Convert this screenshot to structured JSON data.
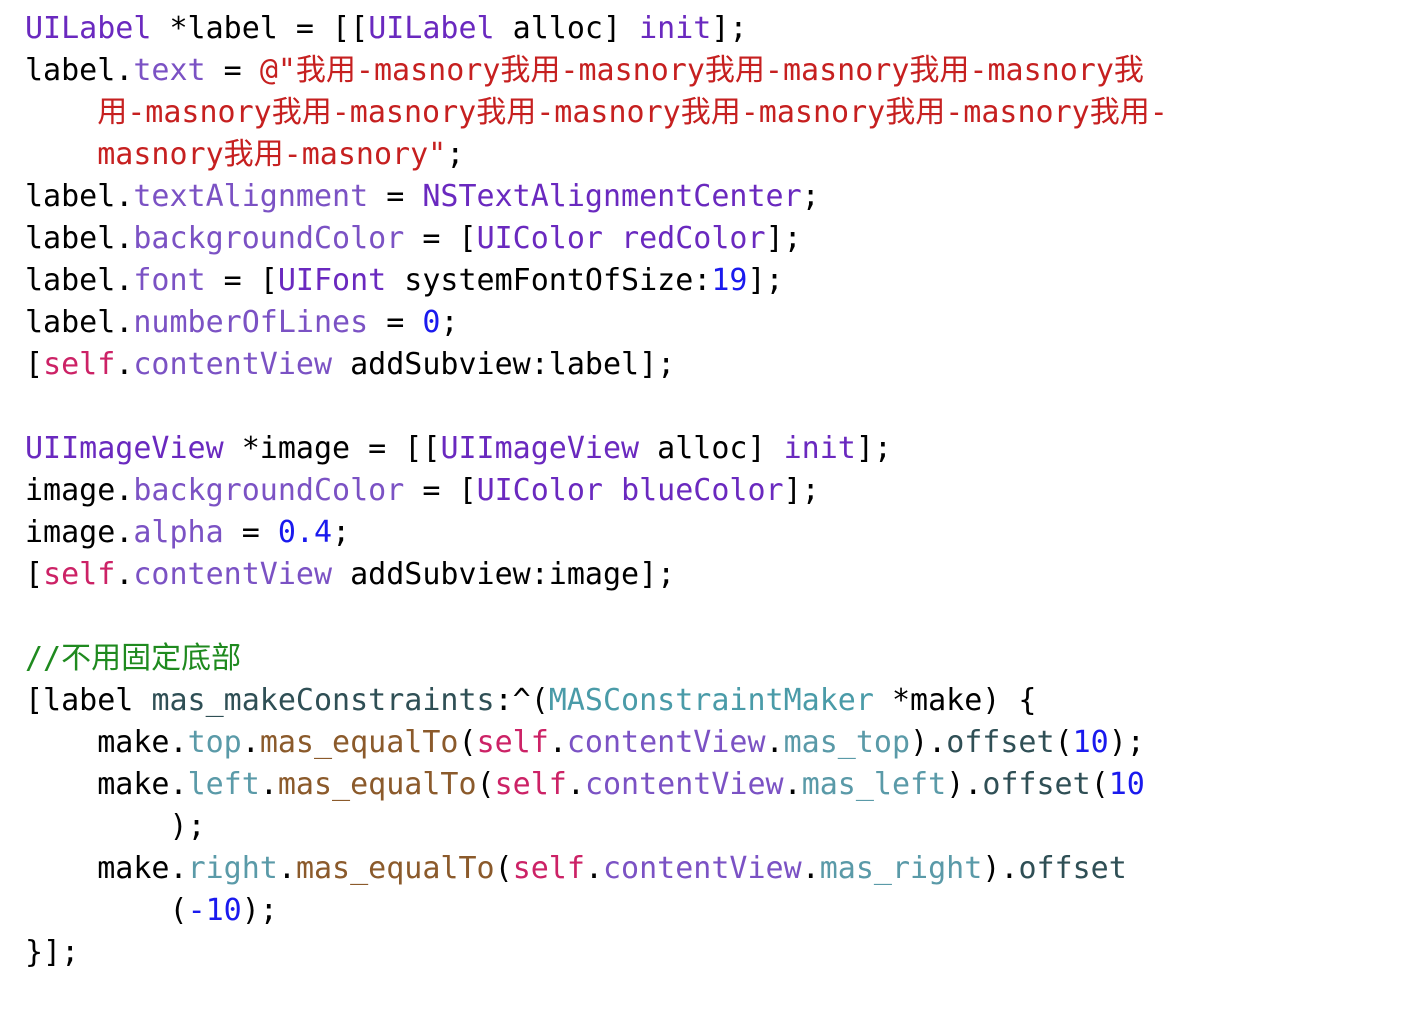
{
  "editor": {
    "language": "Objective-C",
    "background_color": "#FFFFFF",
    "font_size_px": 30,
    "line_height_px": 42,
    "theme_colors": {
      "plain": "#000000",
      "class_name": "#6A29BF",
      "property": "#7B52C4",
      "string": "#C62020",
      "number": "#1A1AEE",
      "self_keyword": "#CC2266",
      "comment": "#1F8A1F",
      "method": "#2F4F55",
      "type_name": "#4A9BA8",
      "attribute": "#5A9AA8",
      "mas_function": "#8B5A2B"
    }
  },
  "code": {
    "label_string_literal": "我用-masnory我用-masnory我用-masnory我用-masnory我用-masnory我用-masnory我用-masnory我用-masnory我用-masnory我用-masnory我用-masnory",
    "comment_text": "//不用固定底部",
    "lines": [
      {
        "id": "line-1",
        "tokens": [
          {
            "text": "UILabel",
            "kind": "class"
          },
          {
            "text": " *label = [[",
            "kind": "plain"
          },
          {
            "text": "UILabel",
            "kind": "class"
          },
          {
            "text": " alloc] ",
            "kind": "plain"
          },
          {
            "text": "init",
            "kind": "class"
          },
          {
            "text": "];",
            "kind": "plain"
          }
        ]
      },
      {
        "id": "line-2",
        "tokens": [
          {
            "text": "label.",
            "kind": "plain"
          },
          {
            "text": "text",
            "kind": "prop"
          },
          {
            "text": " = ",
            "kind": "plain"
          },
          {
            "text": "@\"我用-masnory我用-masnory我用-masnory我用-masnory我",
            "kind": "string"
          }
        ]
      },
      {
        "id": "line-3",
        "indent": 4,
        "tokens": [
          {
            "text": "用-masnory我用-masnory我用-masnory我用-masnory我用-masnory我用-",
            "kind": "string"
          }
        ]
      },
      {
        "id": "line-4",
        "indent": 4,
        "tokens": [
          {
            "text": "masnory我用-masnory\"",
            "kind": "string"
          },
          {
            "text": ";",
            "kind": "plain"
          }
        ]
      },
      {
        "id": "line-5",
        "tokens": [
          {
            "text": "label.",
            "kind": "plain"
          },
          {
            "text": "textAlignment",
            "kind": "prop"
          },
          {
            "text": " = ",
            "kind": "plain"
          },
          {
            "text": "NSTextAlignmentCenter",
            "kind": "class"
          },
          {
            "text": ";",
            "kind": "plain"
          }
        ]
      },
      {
        "id": "line-6",
        "tokens": [
          {
            "text": "label.",
            "kind": "plain"
          },
          {
            "text": "backgroundColor",
            "kind": "prop"
          },
          {
            "text": " = [",
            "kind": "plain"
          },
          {
            "text": "UIColor",
            "kind": "class"
          },
          {
            "text": " ",
            "kind": "plain"
          },
          {
            "text": "redColor",
            "kind": "class"
          },
          {
            "text": "];",
            "kind": "plain"
          }
        ]
      },
      {
        "id": "line-7",
        "tokens": [
          {
            "text": "label.",
            "kind": "plain"
          },
          {
            "text": "font",
            "kind": "prop"
          },
          {
            "text": " = [",
            "kind": "plain"
          },
          {
            "text": "UIFont",
            "kind": "class"
          },
          {
            "text": " systemFontOfSize:",
            "kind": "plain"
          },
          {
            "text": "19",
            "kind": "num"
          },
          {
            "text": "];",
            "kind": "plain"
          }
        ]
      },
      {
        "id": "line-8",
        "tokens": [
          {
            "text": "label.",
            "kind": "plain"
          },
          {
            "text": "numberOfLines",
            "kind": "prop"
          },
          {
            "text": " = ",
            "kind": "plain"
          },
          {
            "text": "0",
            "kind": "num"
          },
          {
            "text": ";",
            "kind": "plain"
          }
        ]
      },
      {
        "id": "line-9",
        "tokens": [
          {
            "text": "[",
            "kind": "plain"
          },
          {
            "text": "self",
            "kind": "self"
          },
          {
            "text": ".",
            "kind": "plain"
          },
          {
            "text": "contentView",
            "kind": "prop"
          },
          {
            "text": " addSubview:label];",
            "kind": "plain"
          }
        ]
      },
      {
        "id": "line-10",
        "blank": true,
        "tokens": []
      },
      {
        "id": "line-11",
        "tokens": [
          {
            "text": "UIImageView",
            "kind": "class"
          },
          {
            "text": " *image = [[",
            "kind": "plain"
          },
          {
            "text": "UIImageView",
            "kind": "class"
          },
          {
            "text": " alloc] ",
            "kind": "plain"
          },
          {
            "text": "init",
            "kind": "class"
          },
          {
            "text": "];",
            "kind": "plain"
          }
        ]
      },
      {
        "id": "line-12",
        "tokens": [
          {
            "text": "image.",
            "kind": "plain"
          },
          {
            "text": "backgroundColor",
            "kind": "prop"
          },
          {
            "text": " = [",
            "kind": "plain"
          },
          {
            "text": "UIColor",
            "kind": "class"
          },
          {
            "text": " ",
            "kind": "plain"
          },
          {
            "text": "blueColor",
            "kind": "class"
          },
          {
            "text": "];",
            "kind": "plain"
          }
        ]
      },
      {
        "id": "line-13",
        "tokens": [
          {
            "text": "image.",
            "kind": "plain"
          },
          {
            "text": "alpha",
            "kind": "prop"
          },
          {
            "text": " = ",
            "kind": "plain"
          },
          {
            "text": "0.4",
            "kind": "num"
          },
          {
            "text": ";",
            "kind": "plain"
          }
        ]
      },
      {
        "id": "line-14",
        "tokens": [
          {
            "text": "[",
            "kind": "plain"
          },
          {
            "text": "self",
            "kind": "self"
          },
          {
            "text": ".",
            "kind": "plain"
          },
          {
            "text": "contentView",
            "kind": "prop"
          },
          {
            "text": " addSubview:image];",
            "kind": "plain"
          }
        ]
      },
      {
        "id": "line-15",
        "blank": true,
        "tokens": []
      },
      {
        "id": "line-16",
        "tokens": [
          {
            "text": "//不用固定底部",
            "kind": "comment"
          }
        ]
      },
      {
        "id": "line-17",
        "tokens": [
          {
            "text": "[label ",
            "kind": "plain"
          },
          {
            "text": "mas_makeConstraints",
            "kind": "method"
          },
          {
            "text": ":^(",
            "kind": "plain"
          },
          {
            "text": "MASConstraintMaker",
            "kind": "type"
          },
          {
            "text": " *make) {",
            "kind": "plain"
          }
        ]
      },
      {
        "id": "line-18",
        "indent": 4,
        "tokens": [
          {
            "text": "make.",
            "kind": "plain"
          },
          {
            "text": "top",
            "kind": "attr"
          },
          {
            "text": ".",
            "kind": "plain"
          },
          {
            "text": "mas_equalTo",
            "kind": "masfn"
          },
          {
            "text": "(",
            "kind": "plain"
          },
          {
            "text": "self",
            "kind": "self"
          },
          {
            "text": ".",
            "kind": "plain"
          },
          {
            "text": "contentView",
            "kind": "prop"
          },
          {
            "text": ".",
            "kind": "plain"
          },
          {
            "text": "mas_top",
            "kind": "attr"
          },
          {
            "text": ").",
            "kind": "plain"
          },
          {
            "text": "offset",
            "kind": "method"
          },
          {
            "text": "(",
            "kind": "plain"
          },
          {
            "text": "10",
            "kind": "num"
          },
          {
            "text": ");",
            "kind": "plain"
          }
        ]
      },
      {
        "id": "line-19",
        "indent": 4,
        "tokens": [
          {
            "text": "make.",
            "kind": "plain"
          },
          {
            "text": "left",
            "kind": "attr"
          },
          {
            "text": ".",
            "kind": "plain"
          },
          {
            "text": "mas_equalTo",
            "kind": "masfn"
          },
          {
            "text": "(",
            "kind": "plain"
          },
          {
            "text": "self",
            "kind": "self"
          },
          {
            "text": ".",
            "kind": "plain"
          },
          {
            "text": "contentView",
            "kind": "prop"
          },
          {
            "text": ".",
            "kind": "plain"
          },
          {
            "text": "mas_left",
            "kind": "attr"
          },
          {
            "text": ").",
            "kind": "plain"
          },
          {
            "text": "offset",
            "kind": "method"
          },
          {
            "text": "(",
            "kind": "plain"
          },
          {
            "text": "10",
            "kind": "num"
          }
        ]
      },
      {
        "id": "line-20",
        "indent": 8,
        "tokens": [
          {
            "text": ");",
            "kind": "plain"
          }
        ]
      },
      {
        "id": "line-21",
        "indent": 4,
        "tokens": [
          {
            "text": "make.",
            "kind": "plain"
          },
          {
            "text": "right",
            "kind": "attr"
          },
          {
            "text": ".",
            "kind": "plain"
          },
          {
            "text": "mas_equalTo",
            "kind": "masfn"
          },
          {
            "text": "(",
            "kind": "plain"
          },
          {
            "text": "self",
            "kind": "self"
          },
          {
            "text": ".",
            "kind": "plain"
          },
          {
            "text": "contentView",
            "kind": "prop"
          },
          {
            "text": ".",
            "kind": "plain"
          },
          {
            "text": "mas_right",
            "kind": "attr"
          },
          {
            "text": ").",
            "kind": "plain"
          },
          {
            "text": "offset",
            "kind": "method"
          }
        ]
      },
      {
        "id": "line-22",
        "indent": 8,
        "tokens": [
          {
            "text": "(",
            "kind": "plain"
          },
          {
            "text": "-10",
            "kind": "num"
          },
          {
            "text": ");",
            "kind": "plain"
          }
        ]
      },
      {
        "id": "line-23",
        "tokens": [
          {
            "text": "}];",
            "kind": "plain"
          }
        ]
      }
    ]
  }
}
